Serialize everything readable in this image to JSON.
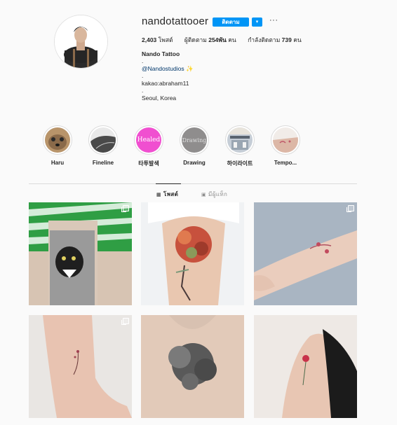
{
  "profile": {
    "username": "nandotattooer",
    "follow_label": "ติดตาม",
    "dropdown_label": "▾",
    "more_label": "···",
    "stats": {
      "posts_count": "2,403",
      "posts_label": "โพสต์",
      "followers_label": "ผู้ติดตาม",
      "followers_count": "254พัน",
      "followers_suffix": "คน",
      "following_label": "กำลังติดตาม",
      "following_count": "739",
      "following_suffix": "คน"
    },
    "bio": {
      "name": "Nando Tattoo",
      "line_dot1": ".",
      "link": "@Nandostudios",
      "sparkle": "✨",
      "line_dot2": ".",
      "kakao": "kakao:abraham11",
      "line_dot3": ".",
      "location": "Seoul, Korea"
    }
  },
  "highlights": [
    {
      "label": "Haru"
    },
    {
      "label": "Fineline"
    },
    {
      "label": "타투발색",
      "cover_text": "Healed"
    },
    {
      "label": "Drawing",
      "cover_text": "Drawing"
    },
    {
      "label": "하이라이트"
    },
    {
      "label": "Tempo..."
    }
  ],
  "tabs": {
    "posts_label": "โพสต์",
    "tagged_label": "มีผู้แท็ก"
  },
  "colors": {
    "accent": "#0095f6",
    "link": "#00376b",
    "healed_cover": "#f04fd0",
    "drawing_cover": "#8f8d8d"
  }
}
